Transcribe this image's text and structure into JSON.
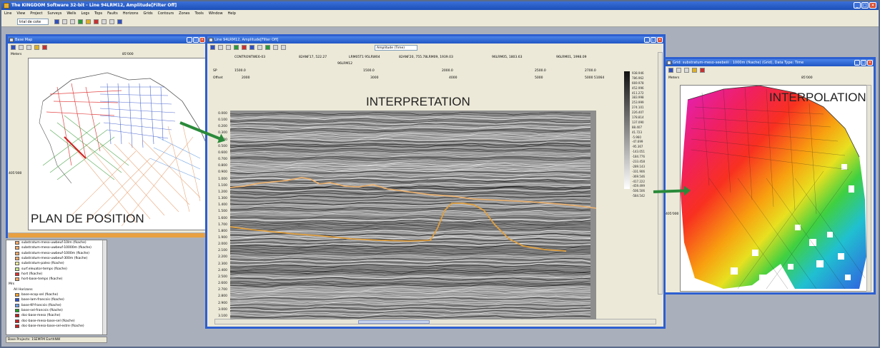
{
  "app": {
    "title": "The KINGDOM Software 32-bit - Line 94LRM12, Amplitude[Filter Off]"
  },
  "menu": [
    "Line",
    "View",
    "Project",
    "Surveys",
    "Wells",
    "Logs",
    "Tops",
    "Faults",
    "Horizons",
    "Grids",
    "Contours",
    "Zones",
    "Tools",
    "Window",
    "Help"
  ],
  "toolbar": {
    "horizon_select": "trial de cote"
  },
  "windows": {
    "base_map": {
      "title": "Base Map",
      "scale_label": "85'000",
      "left_scale": "405'000",
      "caption": "PLAN DE POSITION",
      "unit": "Meters"
    },
    "seismic": {
      "title": "Line 94LRM12, Amplitude[Filter Off]",
      "attr_select": "Amplitude (Time)",
      "caption": "INTERPRETATION",
      "well_labels": [
        "CONTRONTWE6-03",
        "82ANF17, 522.27",
        "LRM05T1 95LRW04",
        "82ANF20, 755.78LRM09, 1939.03",
        "96LRM05, 1803.63",
        "96LRM01, 1998.09"
      ],
      "sub_label": "96LRM12",
      "sp_row": [
        "SP",
        "1500.0",
        "1500.0",
        "2000.0",
        "2500.0",
        "2700.0"
      ],
      "offset_row": [
        "Offset",
        "2000",
        "3000",
        "4000",
        "5000",
        "5000 51064"
      ],
      "depth_ticks": [
        "0.000",
        "0.100",
        "0.200",
        "0.300",
        "0.400",
        "0.500",
        "0.600",
        "0.700",
        "0.800",
        "0.900",
        "1.000",
        "1.100",
        "1.200",
        "1.300",
        "1.400",
        "1.500",
        "1.600",
        "1.700",
        "1.800",
        "1.900",
        "2.000",
        "2.100",
        "2.200",
        "2.300",
        "2.400",
        "2.500",
        "2.600",
        "2.700",
        "2.800",
        "2.900",
        "3.000",
        "3.100"
      ],
      "colorbar_values": [
        "938.946",
        "786.962",
        "669.978",
        "452.996",
        "411.272",
        "383.998",
        "253.999",
        "274.101",
        "226.407",
        "178.814",
        "137.090",
        "88.407",
        "41.723",
        "-5.960",
        "-47.699",
        "-95.367",
        "-143.051",
        "-184.776",
        "-233.458",
        "-289.143",
        "-331.906",
        "-369.546",
        "-417.222",
        "-459.499",
        "-506.506",
        "-584.542"
      ]
    },
    "grid": {
      "title": "Grid: substratum-meso-seebeiii : 1000m (fkache) (Grid), Data Type: Time",
      "scale_label": "85'000",
      "left_scale": "405'000",
      "caption": "INTERPOLATION",
      "unit": "Meters"
    }
  },
  "legend": {
    "items": [
      {
        "label": "substratum-meso-uwbeuf-10lm (fkache)",
        "color": "#f2a868"
      },
      {
        "label": "substratum-meso-uwbeuf-10000m (fkache)",
        "color": "#f2a868"
      },
      {
        "label": "substratum-meso-uwbeuf-1000m (fkache)",
        "color": "#f2a868"
      },
      {
        "label": "substratum-meso-uwbeuf-300m (fkache)",
        "color": "#f2a868"
      },
      {
        "label": "substratum-paleo (fkache)",
        "color": "#f8f8a0"
      },
      {
        "label": "surf.eleuator-temps (fkache)",
        "color": "#c8e890"
      },
      {
        "label": "hort (fkache)",
        "color": "#e03030"
      },
      {
        "label": "hort-base-temps (fkache)",
        "color": "#f2a868"
      }
    ],
    "section_label": "Mrs",
    "section_sub": "All Horizons",
    "horizons": [
      {
        "label": "base-ecop-sel (fkache)",
        "color": "#f2a030"
      },
      {
        "label": "base-lam-francsis (fkache)",
        "color": "#2a50c8"
      },
      {
        "label": "base-Kf-francsis (fkache)",
        "color": "#6aa0e8"
      },
      {
        "label": "base-sel-francsis (fkache)",
        "color": "#20a020"
      },
      {
        "label": "doc-base-meso (fkache)",
        "color": "#c02020"
      },
      {
        "label": "doc-base-meso-base-sel (fkache)",
        "color": "#d02020"
      },
      {
        "label": "doc-base-meso-base-sel-estre (fkache)",
        "color": "#d02020"
      }
    ]
  },
  "status": {
    "text": "Base Projects: 1SEMFM EarthNW"
  },
  "colors": {
    "titlebar": "#1c4fb8",
    "arrow": "#2a8a3a",
    "horizon_top": "#e8b070",
    "horizon_bottom": "#e0a040"
  },
  "icons": [
    "app-icon",
    "minimize-icon",
    "maximize-icon",
    "close-icon",
    "pointer-icon",
    "zoom-in-icon",
    "zoom-out-icon",
    "pan-icon",
    "print-icon",
    "save-icon"
  ]
}
